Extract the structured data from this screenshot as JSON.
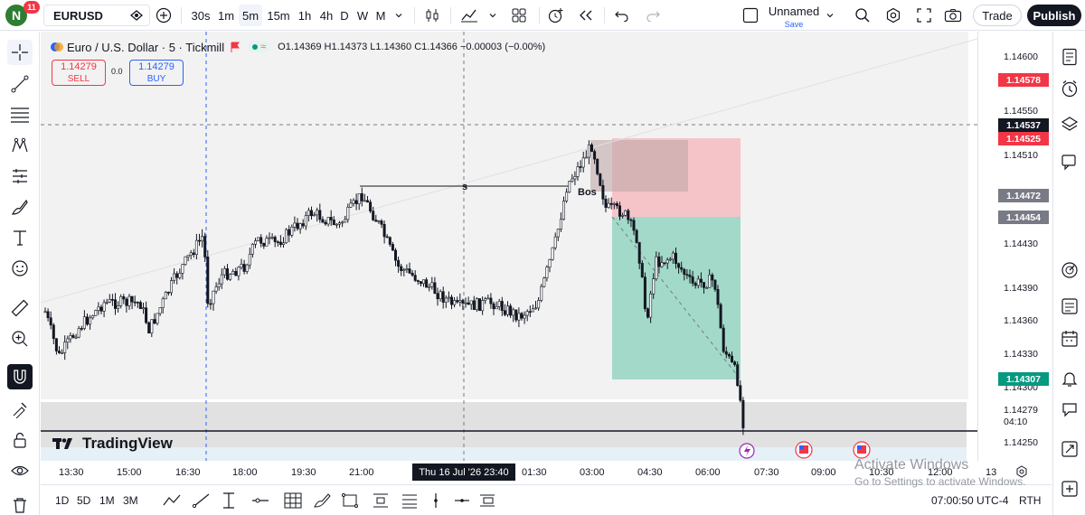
{
  "topbar": {
    "logo_letter": "N",
    "notification_count": "11",
    "symbol": "EURUSD",
    "intervals": [
      "30s",
      "1m",
      "5m",
      "15m",
      "1h",
      "4h",
      "D",
      "W",
      "M"
    ],
    "active_interval": "5m",
    "layout_name": "Unnamed",
    "layout_status": "Save",
    "trade_label": "Trade",
    "publish_label": "Publish"
  },
  "legend": {
    "title": "Euro / U.S. Dollar · 5 · Tickmill",
    "ohlc": "O1.14369 H1.14373 L1.14360 C1.14366 −0.00003 (−0.00%)",
    "sell_price": "1.14279",
    "sell_label": "SELL",
    "spread": "0.0",
    "buy_price": "1.14279",
    "buy_label": "BUY"
  },
  "annotations": {
    "structure_label": "s",
    "bos_label": "Bos"
  },
  "price_axis": {
    "ticks": [
      "1.14600",
      "1.14550",
      "1.14510",
      "1.14430",
      "1.14390",
      "1.14360",
      "1.14330",
      "1.14300",
      "1.14279",
      "1.14250"
    ],
    "countdown": "04:10",
    "tags": [
      {
        "value": "1.14578",
        "color": "#f23645"
      },
      {
        "value": "1.14537",
        "color": "#131722"
      },
      {
        "value": "1.14525",
        "color": "#f23645"
      },
      {
        "value": "1.14472",
        "color": "#787b86"
      },
      {
        "value": "1.14454",
        "color": "#787b86"
      },
      {
        "value": "1.14307",
        "color": "#089981"
      }
    ]
  },
  "time_axis": {
    "labels": [
      "13:30",
      "15:00",
      "16:30",
      "18:00",
      "19:30",
      "21:00",
      "01:30",
      "03:00",
      "04:30",
      "06:00",
      "07:30",
      "09:00",
      "10:30",
      "12:00",
      "13"
    ],
    "cursor_label": "Thu 16 Jul '26   23:40"
  },
  "bottom": {
    "ranges": [
      "1D",
      "5D",
      "1M",
      "3M"
    ],
    "clock": "07:00:50 UTC-4",
    "session": "RTH"
  },
  "watermark": {
    "line1": "Activate Windows",
    "line2": "Go to Settings to activate Windows."
  },
  "branding": {
    "tv_name": "TradingView"
  },
  "colors": {
    "up": "#131722",
    "down": "#131722",
    "stop_zone": "#f7c5cb",
    "target_zone": "#a6dccc"
  }
}
